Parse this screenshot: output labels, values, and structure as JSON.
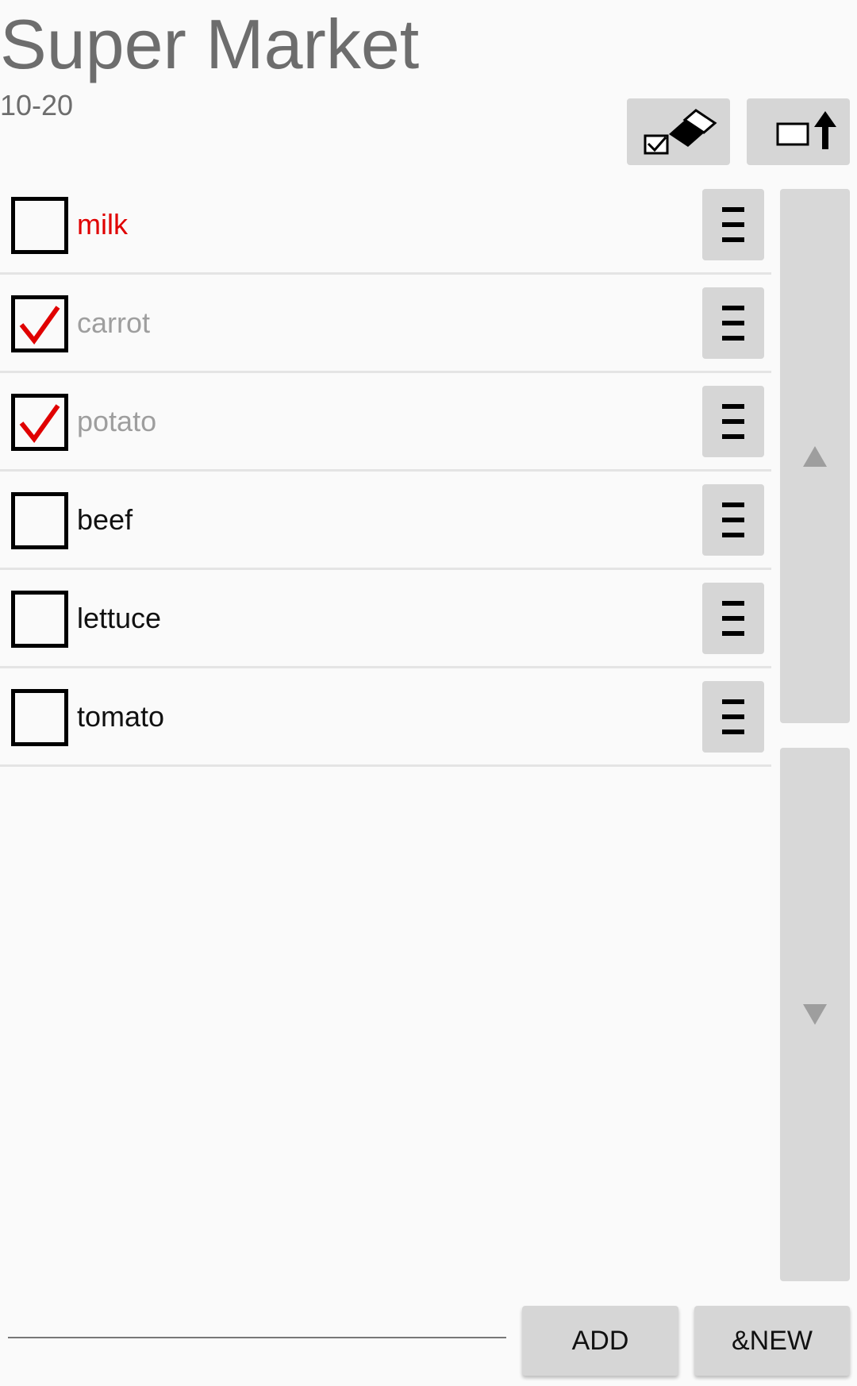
{
  "header": {
    "title": "Super Market",
    "subtitle": "10-20"
  },
  "toolbar": {
    "clear_checked_icon": "eraser-checkbox-icon",
    "export_icon": "box-arrow-up-icon"
  },
  "items": [
    {
      "label": "milk",
      "checked": false,
      "color": "#e00000"
    },
    {
      "label": "carrot",
      "checked": true,
      "color": "#9e9e9e"
    },
    {
      "label": "potato",
      "checked": true,
      "color": "#9e9e9e"
    },
    {
      "label": "beef",
      "checked": false,
      "color": "#111111"
    },
    {
      "label": "lettuce",
      "checked": false,
      "color": "#111111"
    },
    {
      "label": "tomato",
      "checked": false,
      "color": "#111111"
    }
  ],
  "scroll": {
    "up_icon": "triangle-up-icon",
    "down_icon": "triangle-down-icon"
  },
  "footer": {
    "input_value": "",
    "input_placeholder": "",
    "add_label": "ADD",
    "new_label": "&NEW"
  },
  "colors": {
    "check_mark": "#e00000",
    "button_bg": "#d6d6d6"
  }
}
